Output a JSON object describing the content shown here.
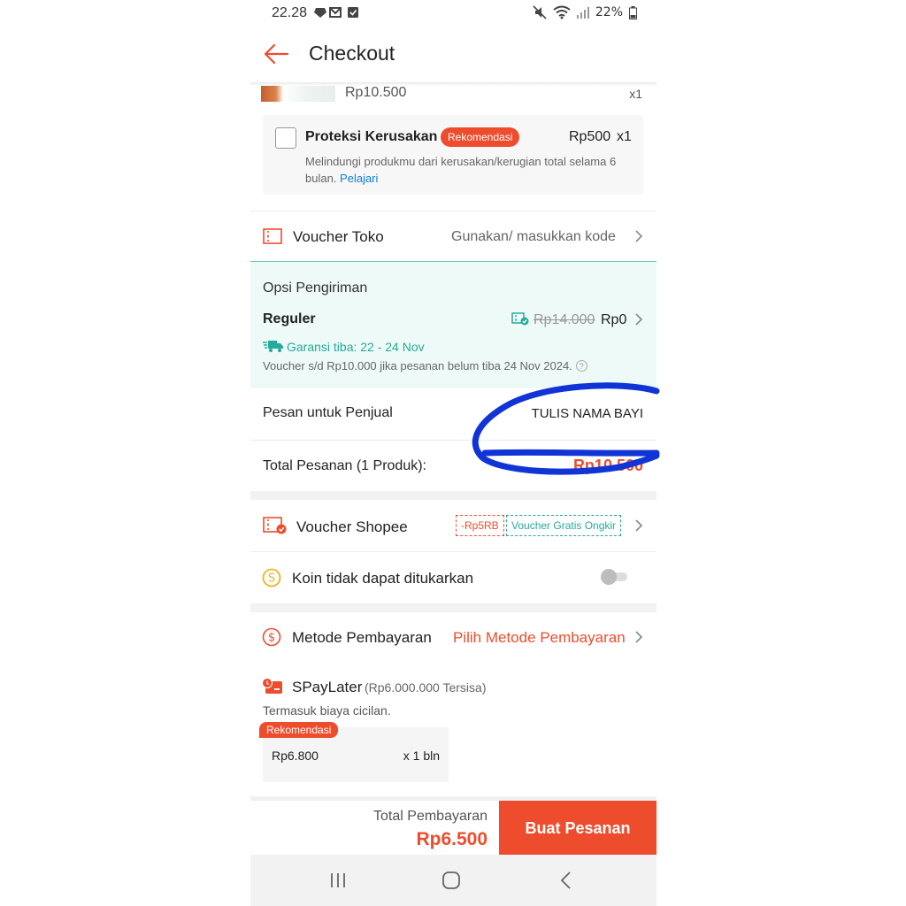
{
  "status_bar": {
    "time": "22.28",
    "battery": "22%"
  },
  "header": {
    "title": "Checkout"
  },
  "product": {
    "price": "Rp10.500",
    "qty": "x1"
  },
  "protection": {
    "title": "Proteksi Kerusakan +",
    "badge": "Rekomendasi",
    "price": "Rp500",
    "qty": "x1",
    "description": "Melindungi produkmu dari kerusakan/kerugian total selama 6 bulan.",
    "link": "Pelajari"
  },
  "voucher_toko": {
    "label": "Voucher Toko",
    "action": "Gunakan/ masukkan kode"
  },
  "shipping": {
    "title": "Opsi Pengiriman",
    "method": "Reguler",
    "old_price": "Rp14.000",
    "new_price": "Rp0",
    "guarantee": "Garansi tiba: 22 - 24 Nov",
    "voucher_note": "Voucher s/d  Rp10.000 jika pesanan belum tiba 24 Nov 2024."
  },
  "seller_note": {
    "label": "Pesan untuk Penjual",
    "value": "TULIS NAMA  BAYI"
  },
  "order_total": {
    "label": "Total Pesanan (1 Produk):",
    "value": "Rp10.500"
  },
  "voucher_shopee": {
    "label": "Voucher Shopee",
    "badge_discount": "-Rp5RB",
    "badge_shipping": "Voucher Gratis Ongkir"
  },
  "coins": {
    "label": "Koin tidak dapat ditukarkan",
    "enabled": false
  },
  "payment": {
    "label": "Metode Pembayaran",
    "action": "Pilih Metode Pembayaran"
  },
  "spaylater": {
    "title": "SPayLater",
    "limit": "(Rp6.000.000 Tersisa)",
    "note": "Termasuk biaya cicilan.",
    "option": {
      "tag": "Rekomendasi",
      "amount": "Rp6.800",
      "tenor": "x 1 bln"
    }
  },
  "checkout": {
    "total_label": "Total Pembayaran",
    "total_value": "Rp6.500",
    "button": "Buat Pesanan"
  },
  "colors": {
    "accent": "#ee4d2d",
    "teal": "#26aa99",
    "scribble": "#1034d6",
    "link": "#0f7fd8"
  },
  "icons": {
    "back": "arrow-left-icon",
    "voucher": "ticket-icon",
    "shipping_voucher": "shipping-voucher-icon",
    "truck": "truck-icon",
    "coin": "coin-icon",
    "payment": "dollar-circle-icon",
    "spaylater": "spaylater-icon"
  }
}
